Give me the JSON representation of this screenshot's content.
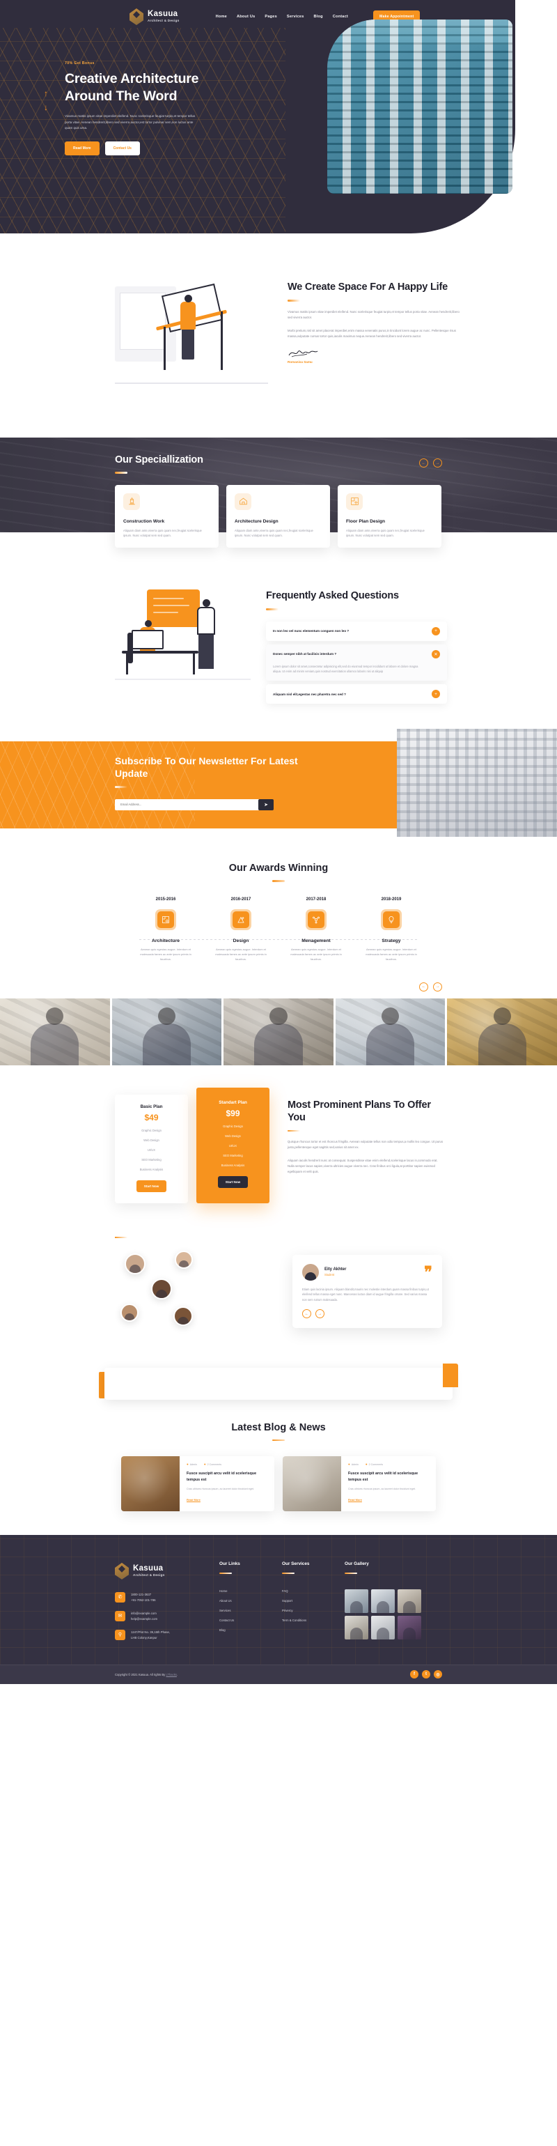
{
  "header": {
    "brand_name": "Kasuua",
    "brand_tagline": "Architect & Design",
    "nav": [
      {
        "label": "Home"
      },
      {
        "label": "About Us"
      },
      {
        "label": "Pages"
      },
      {
        "label": "Services"
      },
      {
        "label": "Blog"
      },
      {
        "label": "Contact"
      }
    ],
    "cta_label": "Make Appointment"
  },
  "hero": {
    "kicker": "70% Get Bonus",
    "title": "Creative Architecture Around The Word",
    "paragraph": "Vivamus mattis ipsum vitae imperdiet eleifend. Nunc scelerisque feugiat turpis,et tempor tellus porta vitae. Aenean hendrerit,libero sed viverra auctor,est tortor pulvinar sem,non luctus ante quam quis urna.",
    "primary_btn": "Read More",
    "ghost_btn": "Contact Us",
    "arrow_up": "↑",
    "arrow_down": "↓"
  },
  "create": {
    "title": "We Create Space For A Happy Life",
    "p1": "Vivamus mattis ipsum vitae imperdiet eleifend. Nunc scelerisque feugiat turpis,et tempor tellus porta vitae. Aenean hendrerit,libero sed viverra auctor.",
    "p2": "Morbi pretium,nisl sit amet placerat imperdiet,enim massa venenatis purus,in tincidunt lorem augue ac nunc. Pellentesque risus massa,vulputate cursus tortor quis,iaculis maximus neque.Aenean hendrerit,libero sed viverra auctor.",
    "signature_name": "Romanisa Samu"
  },
  "specialization": {
    "title": "Our Speciallization",
    "prev": "←",
    "next": "→",
    "cards": [
      {
        "icon": "crane-icon",
        "glyph": "🏗",
        "title": "Construction Work",
        "text": "Aliquam diam ante,viverra quis quam nec,feugiat scelerisque ipsum. Nunc volutpat sem sed quam."
      },
      {
        "icon": "house-blueprint-icon",
        "glyph": "🏠",
        "title": "Architecture Design",
        "text": "Aliquam diam ante,viverra quis quam nec,feugiat scelerisque ipsum. Nunc volutpat sem sed quam."
      },
      {
        "icon": "floorplan-icon",
        "glyph": "🗺",
        "title": "Floor Plan Design",
        "text": "Aliquam diam ante,viverra quis quam nec,feugiat scelerisque ipsum. Nunc volutpat sem sed quam."
      }
    ]
  },
  "faq": {
    "title": "Frequently Asked Questions",
    "items": [
      {
        "q": "In non leo vel nunc elementum conguen non leo ?",
        "icon": "plus-icon",
        "glyph": "+",
        "open": false,
        "a": ""
      },
      {
        "q": "Donec semper nibh at facilisis interdum ?",
        "icon": "close-icon",
        "glyph": "✕",
        "open": true,
        "a": "Lorem ipsum dolor sit amet,consectetur adipisicing elit,sed do eiusmod tempor incididunt ut labore et dolore magna aliqua. Ut enim ad minim veniam,quis nostrud exercitation ullamco laboris nisi ut aliquip"
      },
      {
        "q": "Aliquam nisl elit,egestas nec pharetra nec sed ?",
        "icon": "plus-icon",
        "glyph": "+",
        "open": false,
        "a": ""
      }
    ]
  },
  "newsletter": {
    "title": "Subscribe To Our Newsletter For Latest Update",
    "input_placeholder": "Email Address...",
    "submit_glyph": "➤"
  },
  "awards": {
    "title": "Our Awards Winning",
    "items": [
      {
        "year": "2015-2016",
        "icon": "floorplan-icon",
        "glyph": "🏢",
        "name": "Architecture",
        "text": "Aenean quis egestas augue. Interdum et malesuada fames ac ante ipsum primis in faucibus."
      },
      {
        "year": "2016-2017",
        "icon": "drafting-icon",
        "glyph": "📐",
        "name": "Design",
        "text": "Aenean quis egestas augue. Interdum et malesuada fames ac ante ipsum primis in faucibus."
      },
      {
        "year": "2017-2018",
        "icon": "network-icon",
        "glyph": "⚙",
        "name": "Menagement",
        "text": "Aenean quis egestas augue. Interdum et malesuada fames ac ante ipsum primis in faucibus."
      },
      {
        "year": "2018-2019",
        "icon": "lightbulb-icon",
        "glyph": "💡",
        "name": "Strategy",
        "text": "Aenean quis egestas augue. Interdum et malesuada fames ac ante ipsum primis in faucibus."
      }
    ]
  },
  "gallery": {
    "prev": "←",
    "next": "→",
    "items": [
      {
        "name": "gallery-image-1"
      },
      {
        "name": "gallery-image-2"
      },
      {
        "name": "gallery-image-3"
      },
      {
        "name": "gallery-image-4"
      },
      {
        "name": "gallery-image-5"
      }
    ]
  },
  "pricing": {
    "heading": "Most Prominent Plans To Offer You",
    "p1": "Quisque rhoncus tortor et est rhoncus fringilla. Aenean vulputate tellus non odio tempus,a mollis leo congue. Ut purus justo,pellentesque eget sagittis sed,varius sit amet ex.",
    "p2": "Aliquam iaculis hendrerit nunc at consequat. Suspendisse vitae enim eleifend,scelerisque lacus in,commodo erat. Nulla semper lacus sapien,viverra ultricies augue viverra nec. Cras finibus orci ligula,at porttitor sapien euismod egetliquam et velit quis.",
    "plans": [
      {
        "name": "Basic Plan",
        "price": "$49",
        "features": [
          "Graphic Design",
          "Web Design",
          "UI/UX",
          "SEO Marketing",
          "Business Analysis"
        ],
        "btn": "Start Now",
        "featured": false
      },
      {
        "name": "Standart Plan",
        "price": "$99",
        "features": [
          "Graphic Design",
          "Web Design",
          "UI/UX",
          "SEO Marketing",
          "Business Analysis"
        ],
        "btn": "Start Now",
        "featured": true
      }
    ]
  },
  "testimonial": {
    "name": "Eity Akhter",
    "role": "Student",
    "quote_glyph": "❞",
    "text": "Etiam quis lacinia ipsum. Aliquam blandit,mauris nec molestie interdum,quam massa finibus turpis,ut eleifend tellus massa eget nunc. Maecenas luctus diam id augue fringilla ornare. Sed varius massa non sem rutrum malesuada.",
    "prev": "←",
    "next": "→"
  },
  "blog": {
    "title": "Latest Blog & News",
    "posts": [
      {
        "date_icon": "calendar-icon",
        "date": "Admin",
        "comment_icon": "comment-icon",
        "comments": "2 Comments",
        "title": "Fusce suscipit arcu velit id scelerisque tempus est",
        "excerpt": "Cras ultrices rhoncus ipsum, ac laoreet dolor tincidunt eget.",
        "more": "Read More"
      },
      {
        "date_icon": "calendar-icon",
        "date": "Admin",
        "comment_icon": "comment-icon",
        "comments": "2 Comments",
        "title": "Fusce suscipit arcu velit id scelerisque tempus est",
        "excerpt": "Cras ultrices rhoncus ipsum, ac laoreet dolor tincidunt eget.",
        "more": "Read More"
      }
    ]
  },
  "footer": {
    "brand_name": "Kasuua",
    "brand_tagline": "Architect & Design",
    "contact": [
      {
        "icon": "phone-icon",
        "glyph": "✆",
        "lines": [
          "1800-121-3637",
          "+91-7052-101-786"
        ]
      },
      {
        "icon": "mail-icon",
        "glyph": "✉",
        "lines": [
          "info@example.com",
          "help@example.com"
        ]
      },
      {
        "icon": "location-icon",
        "glyph": "⚲",
        "lines": [
          "1247/Plot No. 39,15th Phase,",
          "LHB Colony,Kanpur"
        ]
      }
    ],
    "links_col": {
      "heading": "Our Links",
      "items": [
        "Home",
        "About Us",
        "Services",
        "Contact Us",
        "Blog"
      ]
    },
    "services_col": {
      "heading": "Our Services",
      "items": [
        "FAQ",
        "Support",
        "Privercy",
        "Term & Conditions"
      ]
    },
    "gallery_col": {
      "heading": "Our Gallery",
      "items": [
        "g1",
        "g2",
        "g3",
        "g4",
        "g5",
        "g6"
      ]
    },
    "copyright_pre": "Copyright © 2021 Kasuua. All rights By ",
    "copyright_link": "LThacks",
    "copyright_post": ".",
    "social": [
      {
        "icon": "facebook-icon",
        "glyph": "f"
      },
      {
        "icon": "twitter-icon",
        "glyph": "t"
      },
      {
        "icon": "instagram-icon",
        "glyph": "◎"
      }
    ]
  },
  "colors": {
    "accent": "#f7931e",
    "dark": "#302d3d",
    "text": "#21212c",
    "muted": "#9a9aa6"
  }
}
